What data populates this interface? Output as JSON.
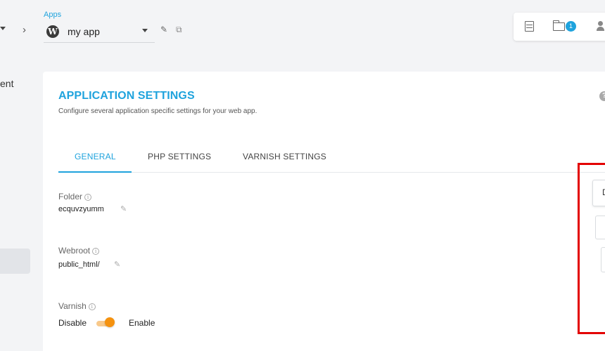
{
  "header": {
    "breadcrumb_label": "Apps",
    "app_name": "my app",
    "separator": "›",
    "notification_count": "1"
  },
  "sidebar": {
    "partial_text": "ent"
  },
  "card": {
    "title": "APPLICATION SETTINGS",
    "subtitle": "Configure several application specific settings for your web app.",
    "tabs": [
      {
        "label": "GENERAL",
        "active": true
      },
      {
        "label": "PHP SETTINGS",
        "active": false
      },
      {
        "label": "VARNISH SETTINGS",
        "active": false
      }
    ],
    "fields": {
      "folder_label": "Folder",
      "folder_value": "ecquvzyumm",
      "webroot_label": "Webroot",
      "webroot_value": "public_html/",
      "varnish_label": "Varnish",
      "varnish_off_label": "Disable",
      "varnish_on_label": "Enable",
      "varnish_enabled": true
    }
  },
  "right_panel": {
    "partial_text": "D"
  },
  "colors": {
    "accent": "#1fa3dd",
    "toggle": "#f5920f",
    "highlight_box": "#e30000"
  }
}
